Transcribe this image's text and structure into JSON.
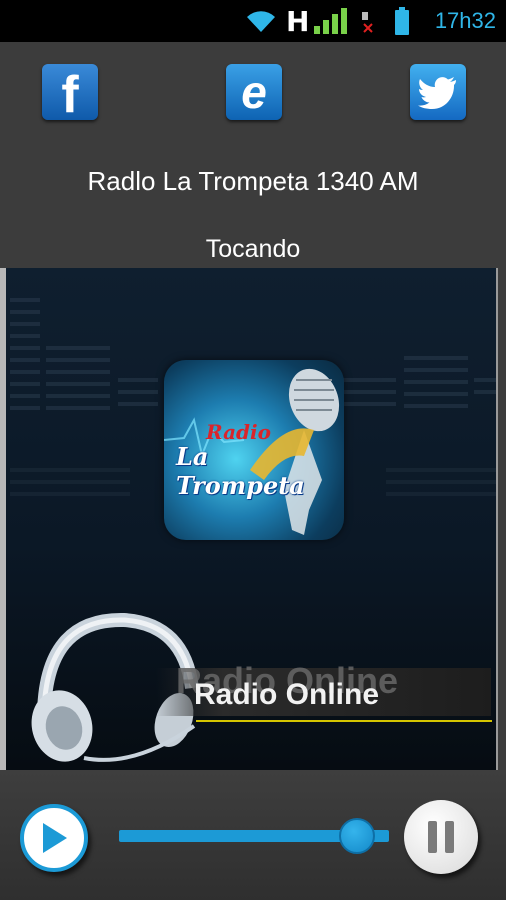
{
  "status_bar": {
    "time": "17h32",
    "network_label": "H",
    "icons": [
      "wifi-icon",
      "signal-icon",
      "no-sim-icon",
      "battery-icon"
    ]
  },
  "social": [
    {
      "name": "facebook",
      "label": "f"
    },
    {
      "name": "internet-explorer",
      "label": "e"
    },
    {
      "name": "twitter",
      "label": "twitter-bird-icon"
    }
  ],
  "station": {
    "title": "Radlo La Trompeta 1340 AM",
    "playing_label": "Tocando"
  },
  "cover": {
    "radio_text": "Radio",
    "name_text": "La Trompeta"
  },
  "banner": {
    "text": "Radio Online"
  },
  "player": {
    "progress_fraction": 0.88,
    "colors": {
      "accent": "#1c9ad6",
      "background": "#3c3c3c"
    }
  }
}
